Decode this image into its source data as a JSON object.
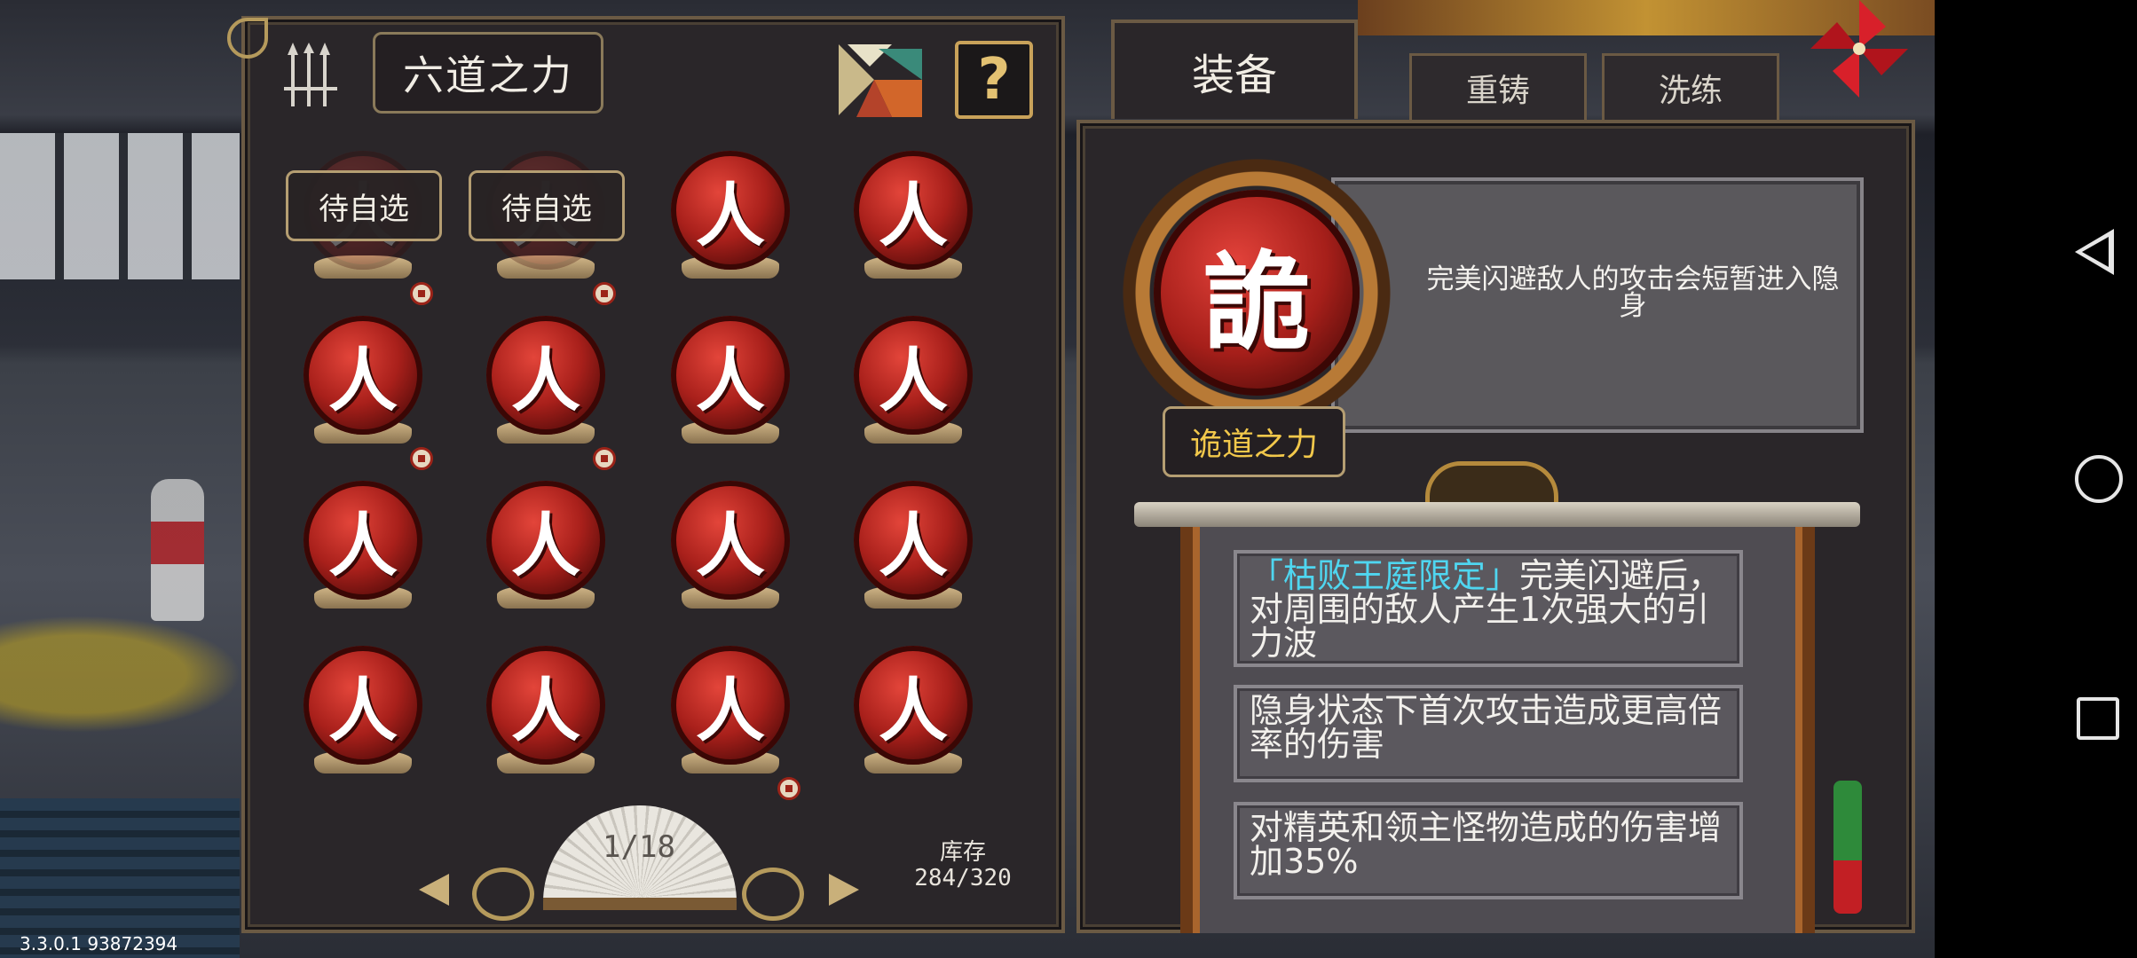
{
  "left_panel": {
    "title": "六道之力",
    "help_label": "?",
    "pending_label": "待自选",
    "orb_glyph": "人",
    "page_indicator": "1/18",
    "stock_label": "库存",
    "stock_value": "284/320"
  },
  "tabs": {
    "equip": "装备",
    "recast": "重铸",
    "refine": "洗练"
  },
  "equipment": {
    "glyph": "詭",
    "name": "诡道之力",
    "description": "完美闪避敌人的攻击会短暂进入隐身"
  },
  "effects": {
    "effect_1_tag": "「枯败王庭限定」",
    "effect_1_text": "完美闪避后，对周围的敌人产生1次强大的引力波",
    "effect_2_text": "隐身状态下首次攻击造成更高倍率的伤害",
    "effect_3_text": "对精英和领主怪物造成的伤害增加35%"
  },
  "footer": {
    "version": "3.3.0.1 93872394"
  },
  "colors": {
    "accent_gold": "#c9a25a",
    "orb_red": "#a9201b",
    "power_name": "#f2c84b",
    "limited_tag": "#4fd6f0"
  },
  "icons": [
    "weapon-rack-icon",
    "tangram-icon",
    "help-icon",
    "lock-badge-icon",
    "pinwheel-icon",
    "nav-back-icon",
    "nav-home-icon",
    "nav-recents-icon"
  ]
}
